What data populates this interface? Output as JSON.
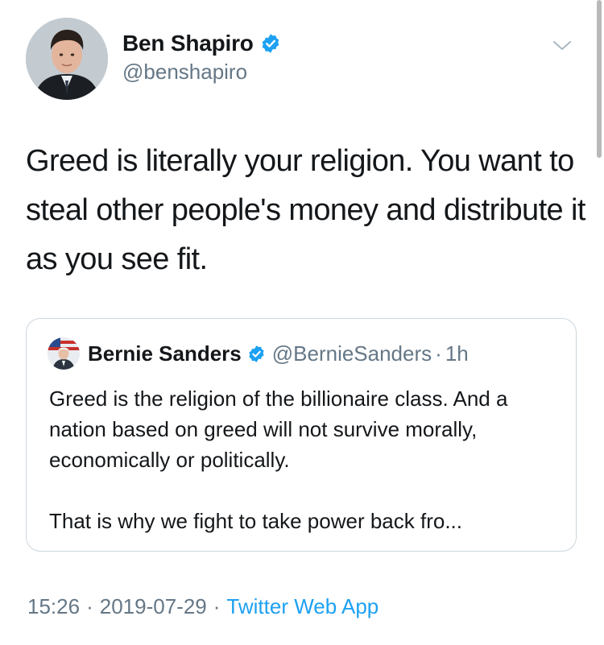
{
  "tweet": {
    "author": {
      "name": "Ben Shapiro",
      "handle": "@benshapiro"
    },
    "text": "Greed is literally your religion. You want to steal other people's money and distribute it as you see fit.",
    "quoted": {
      "name": "Bernie Sanders",
      "handle": "@BernieSanders",
      "separator": "·",
      "time": "1h",
      "paragraph1": "Greed is the religion of the billionaire class. And a nation based on greed will not survive morally, economically or politically.",
      "paragraph2": "That is why we fight to take power back fro..."
    },
    "meta": {
      "time": "15:26",
      "separator": "·",
      "date": "2019-07-29",
      "app": "Twitter Web App"
    }
  },
  "icons": {
    "verified": "verified-badge-icon",
    "menu": "chevron-down-icon"
  },
  "colors": {
    "verified": "#1da1f2",
    "link": "#1da1f2",
    "text": "#14171a",
    "secondary": "#657786",
    "border": "#ccd6dd"
  }
}
